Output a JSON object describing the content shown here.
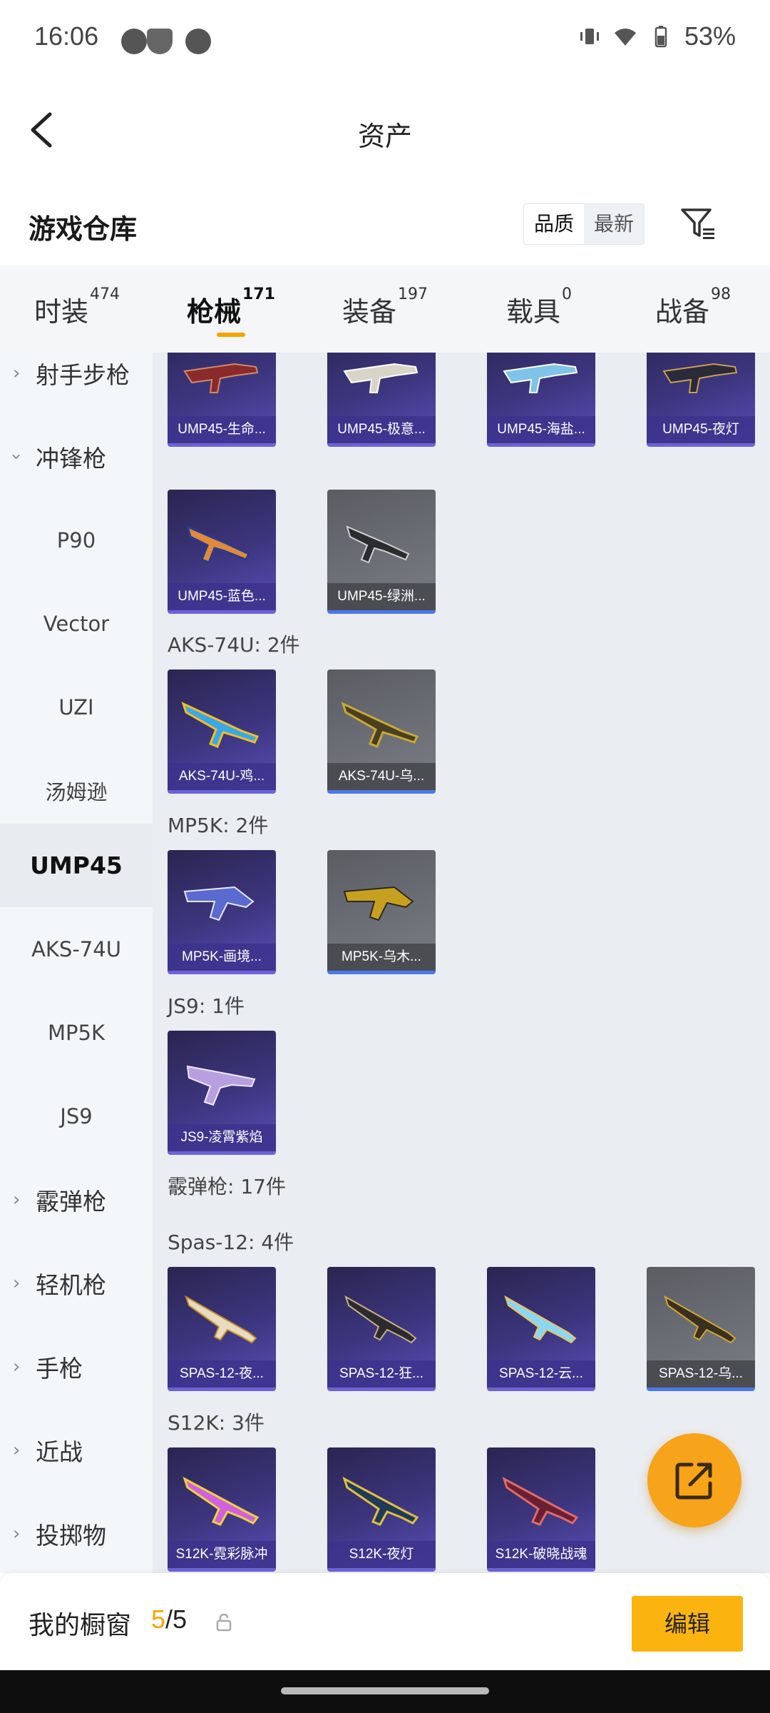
{
  "status": {
    "time": "16:06",
    "battery": "53%"
  },
  "nav": {
    "title": "资产"
  },
  "warehouse": {
    "title": "游戏仓库",
    "sort_quality": "品质",
    "sort_latest": "最新"
  },
  "tabs": [
    {
      "label": "时装",
      "count": "474"
    },
    {
      "label": "枪械",
      "count": "171"
    },
    {
      "label": "装备",
      "count": "197"
    },
    {
      "label": "载具",
      "count": "0"
    },
    {
      "label": "战备",
      "count": "98"
    }
  ],
  "sidebar": {
    "items": [
      {
        "label": "射手步枪"
      },
      {
        "label": "冲锋枪"
      },
      {
        "label": "P90"
      },
      {
        "label": "Vector"
      },
      {
        "label": "UZI"
      },
      {
        "label": "汤姆逊"
      },
      {
        "label": "UMP45"
      },
      {
        "label": "AKS-74U"
      },
      {
        "label": "MP5K"
      },
      {
        "label": "JS9"
      },
      {
        "label": "霰弹枪"
      },
      {
        "label": "轻机枪"
      },
      {
        "label": "手枪"
      },
      {
        "label": "近战"
      },
      {
        "label": "投掷物"
      }
    ]
  },
  "groups": [
    {
      "label": "AKS-74U: 2件"
    },
    {
      "label": "MP5K: 2件"
    },
    {
      "label": "JS9: 1件"
    },
    {
      "label": "霰弹枪: 17件"
    },
    {
      "label": "Spas-12: 4件"
    },
    {
      "label": "S12K: 3件"
    }
  ],
  "cards": [
    {
      "name": "UMP45-生命..."
    },
    {
      "name": "UMP45-极意..."
    },
    {
      "name": "UMP45-海盐..."
    },
    {
      "name": "UMP45-夜灯"
    },
    {
      "name": "UMP45-蓝色..."
    },
    {
      "name": "UMP45-绿洲..."
    },
    {
      "name": "AKS-74U-鸡..."
    },
    {
      "name": "AKS-74U-乌..."
    },
    {
      "name": "MP5K-画境..."
    },
    {
      "name": "MP5K-乌木..."
    },
    {
      "name": "JS9-凌霄紫焰"
    },
    {
      "name": "SPAS-12-夜..."
    },
    {
      "name": "SPAS-12-狂..."
    },
    {
      "name": "SPAS-12-云..."
    },
    {
      "name": "SPAS-12-乌..."
    },
    {
      "name": "S12K-霓彩脉冲"
    },
    {
      "name": "S12K-夜灯"
    },
    {
      "name": "S12K-破晓战魂"
    }
  ],
  "showcase": {
    "label": "我的橱窗",
    "current": "5",
    "total": "/5",
    "edit_label": "编辑"
  },
  "colors": {
    "accent": "#f7a400",
    "card_purple": "#3d3680",
    "card_grey": "#6d7077",
    "rarity_blue": "#4c78e8"
  }
}
